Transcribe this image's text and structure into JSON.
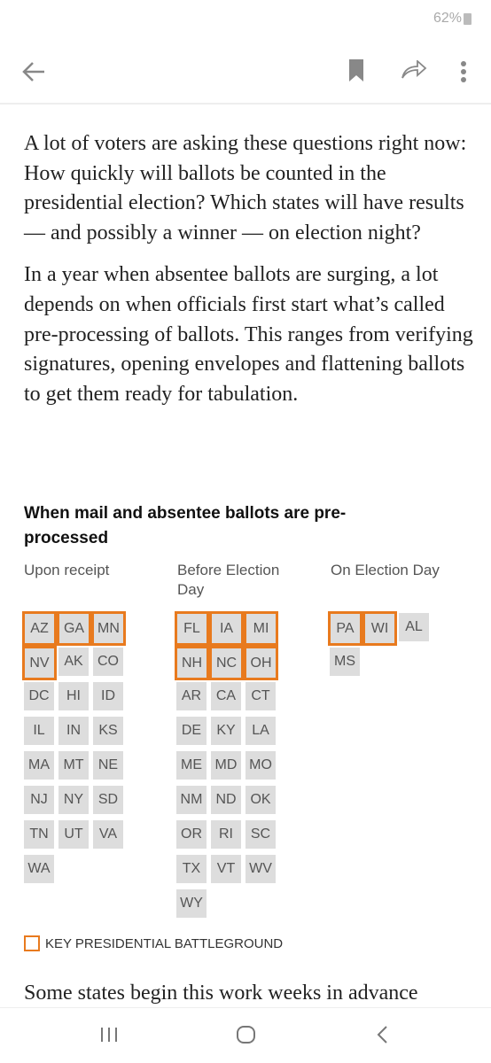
{
  "status_bar": {
    "battery": "62%"
  },
  "toolbar": {
    "back_icon": "arrow-left",
    "bookmark_icon": "bookmark",
    "share_icon": "share-arrow",
    "more_icon": "more-vertical"
  },
  "article": {
    "paragraphs": [
      "A lot of voters are asking these questions right now: How quickly will ballots be counted in the presidential election? Which states will have results — and possibly a winner — on election night?",
      "In a year when absentee ballots are surging, a lot depends on when officials first start what’s called pre-processing of ballots. This ranges from verifying signatures, opening envelopes and flattening ballots to get them ready for tabulation."
    ],
    "tail": "Some states begin this work weeks in advance"
  },
  "graphic": {
    "title": "When mail and absentee ballots are pre-processed",
    "columns": [
      {
        "label": "Upon receipt",
        "states": [
          "AZ",
          "GA",
          "MN",
          "NV",
          "AK",
          "CO",
          "DC",
          "HI",
          "ID",
          "IL",
          "IN",
          "KS",
          "MA",
          "MT",
          "NE",
          "NJ",
          "NY",
          "SD",
          "TN",
          "UT",
          "VA",
          "WA"
        ],
        "battleground": [
          "AZ",
          "GA",
          "MN",
          "NV"
        ]
      },
      {
        "label": "Before Election Day",
        "states": [
          "FL",
          "IA",
          "MI",
          "NH",
          "NC",
          "OH",
          "AR",
          "CA",
          "CT",
          "DE",
          "KY",
          "LA",
          "ME",
          "MD",
          "MO",
          "NM",
          "ND",
          "OK",
          "OR",
          "RI",
          "SC",
          "TX",
          "VT",
          "WV",
          "WY"
        ],
        "battleground": [
          "FL",
          "IA",
          "MI",
          "NH",
          "NC",
          "OH"
        ]
      },
      {
        "label": "On Election Day",
        "states": [
          "PA",
          "WI",
          "AL",
          "MS"
        ],
        "battleground": [
          "PA",
          "WI"
        ]
      }
    ],
    "legend": "KEY PRESIDENTIAL BATTLEGROUND",
    "colors": {
      "battleground_outline": "#e87a1e",
      "tile": "#dddddd"
    }
  }
}
